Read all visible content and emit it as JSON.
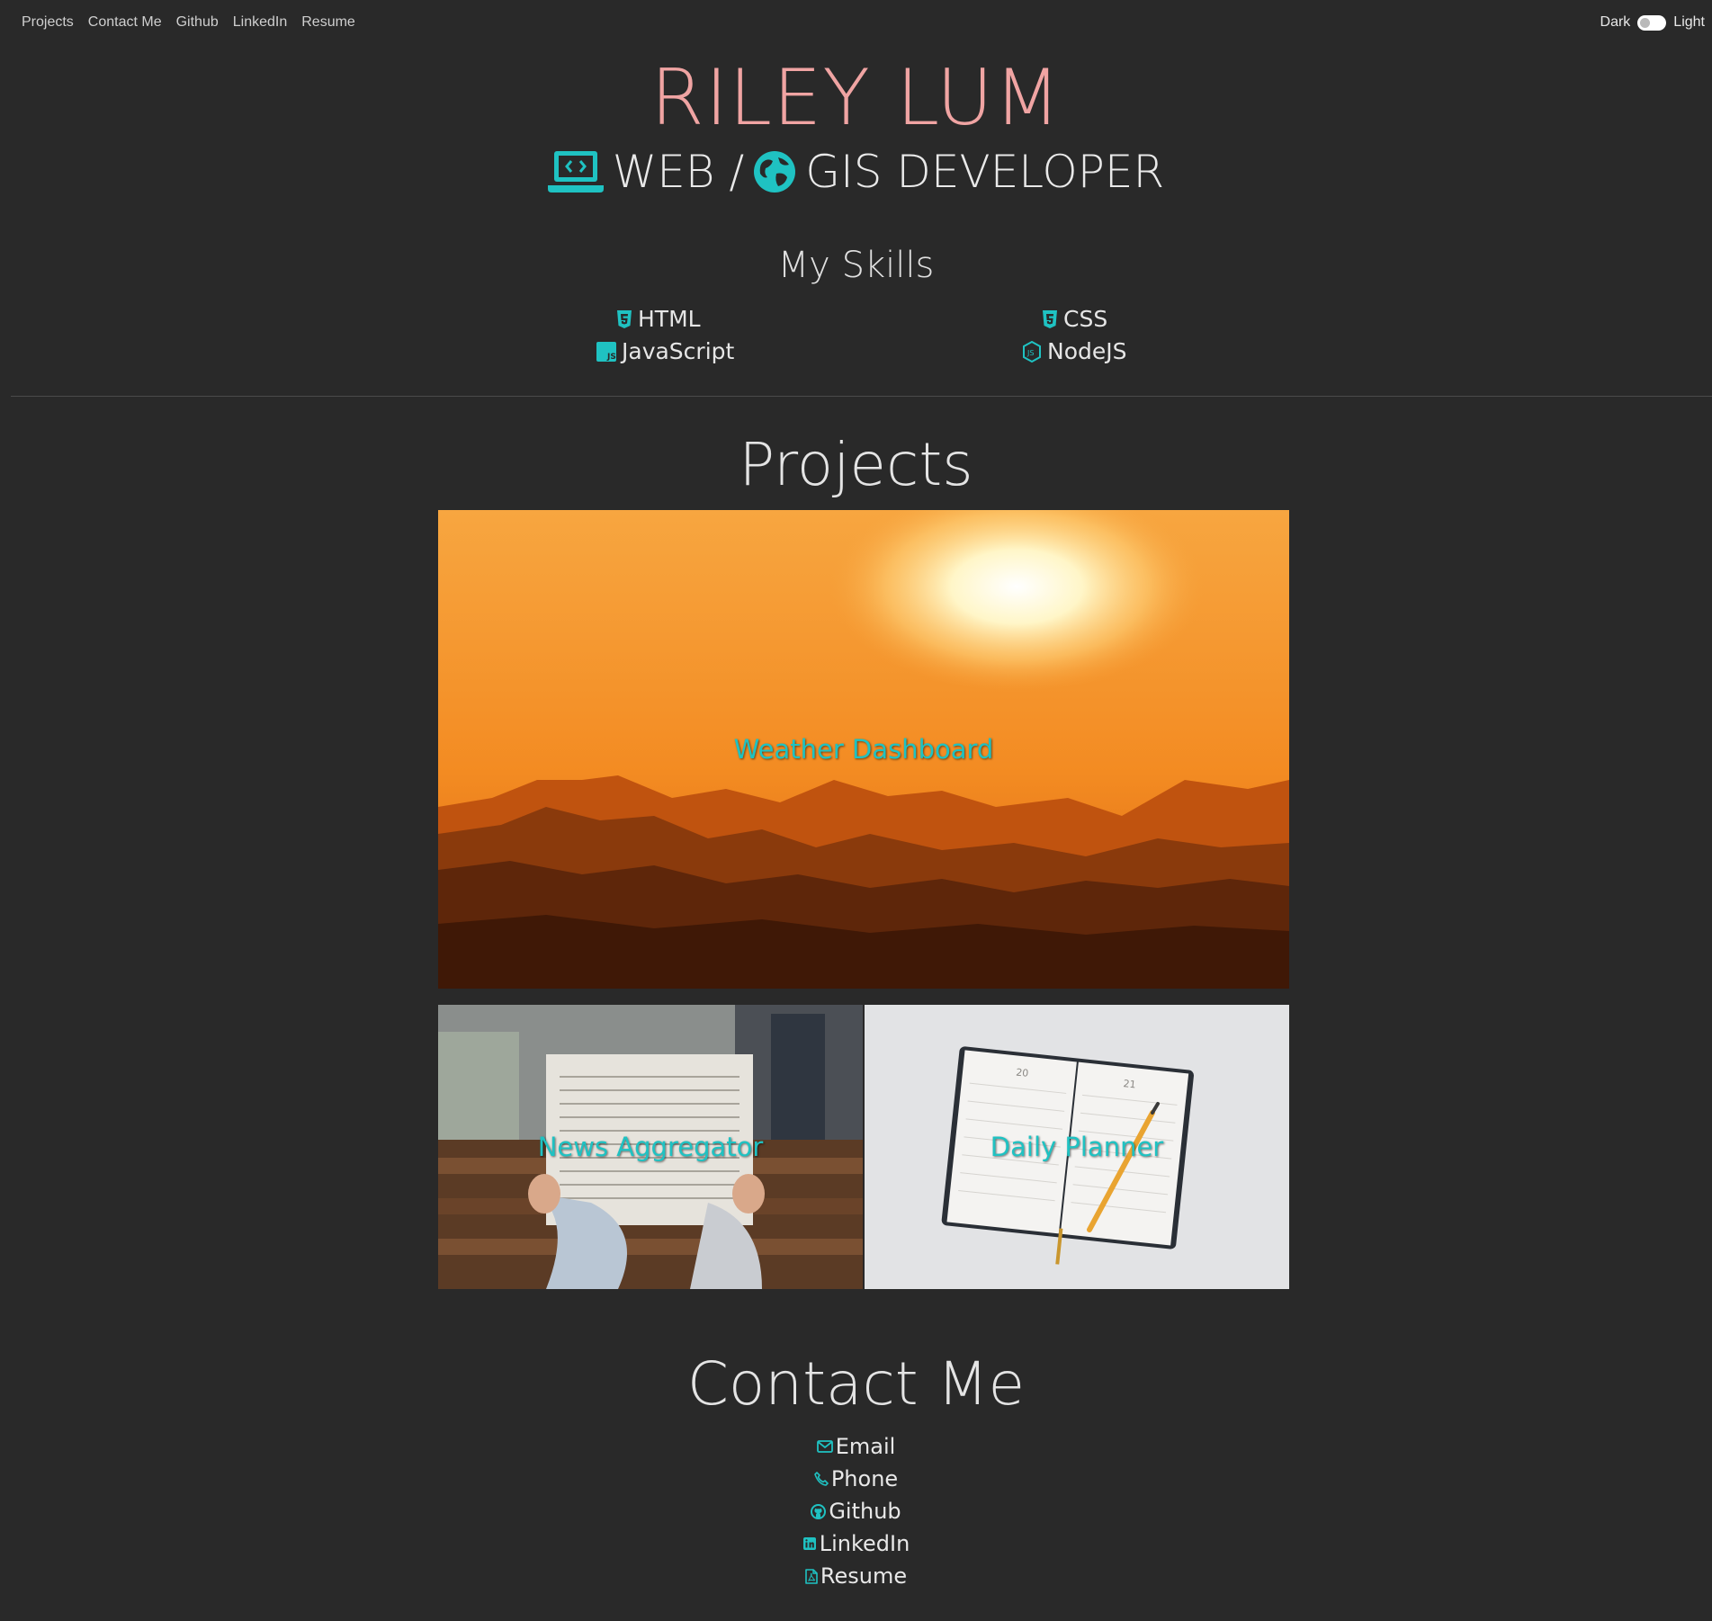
{
  "nav": {
    "items": [
      "Projects",
      "Contact Me",
      "Github",
      "LinkedIn",
      "Resume"
    ]
  },
  "theme": {
    "dark_label": "Dark",
    "light_label": "Light"
  },
  "header": {
    "name": "RILEY LUM",
    "role_web": "WEB /",
    "role_gis": "GIS DEVELOPER"
  },
  "skills": {
    "title": "My Skills",
    "items": [
      {
        "label": "HTML",
        "icon": "html5-icon"
      },
      {
        "label": "CSS",
        "icon": "css3-icon"
      },
      {
        "label": "JavaScript",
        "icon": "js-icon"
      },
      {
        "label": "NodeJS",
        "icon": "nodejs-icon"
      }
    ]
  },
  "projects": {
    "title": "Projects",
    "items": [
      {
        "label": "Weather Dashboard",
        "image": "sunset-mountains"
      },
      {
        "label": "News Aggregator",
        "image": "person-reading-newspaper"
      },
      {
        "label": "Daily Planner",
        "image": "open-planner-with-pencil"
      }
    ]
  },
  "contact": {
    "title": "Contact Me",
    "items": [
      {
        "label": "Email",
        "icon": "envelope-icon"
      },
      {
        "label": "Phone",
        "icon": "phone-icon"
      },
      {
        "label": "Github",
        "icon": "github-icon"
      },
      {
        "label": "LinkedIn",
        "icon": "linkedin-icon"
      },
      {
        "label": "Resume",
        "icon": "pdf-file-icon"
      }
    ]
  },
  "colors": {
    "background": "#292929",
    "accent": "#1fc2c2",
    "name": "#f0a4a3",
    "text": "#e4e4e4"
  }
}
